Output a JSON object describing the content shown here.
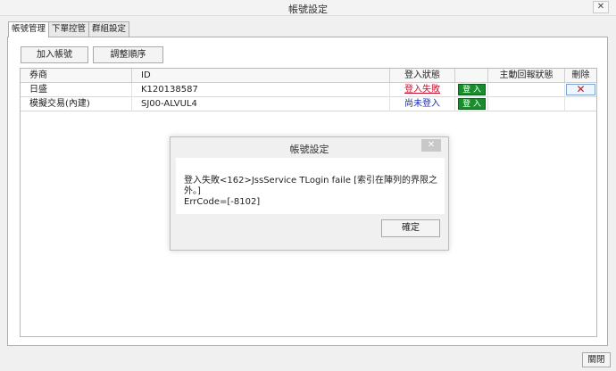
{
  "window": {
    "title": "帳號設定",
    "close_glyph": "✕"
  },
  "tabs": [
    {
      "label": "帳號管理",
      "active": true
    },
    {
      "label": "下單控管",
      "active": false
    },
    {
      "label": "群組設定",
      "active": false
    }
  ],
  "toolbar": {
    "add_account_label": "加入帳號",
    "reorder_label": "調整順序"
  },
  "grid": {
    "columns": [
      "券商",
      "ID",
      "登入狀態",
      "",
      "主動回報狀態",
      "刪除"
    ],
    "rows": [
      {
        "broker": "日盛",
        "id": "K120138587",
        "login_status": "登入失敗",
        "login_button": "登 入",
        "report_status": "",
        "delete_glyph": "✕"
      },
      {
        "broker": "模擬交易(內建)",
        "id": "SJ00-ALVUL4",
        "login_status": "尚未登入",
        "login_button": "登 入",
        "report_status": ""
      }
    ]
  },
  "dialog": {
    "title": "帳號設定",
    "close_glyph": "✕",
    "message_line1": "登入失敗<162>JssService TLogin faile [索引在陣列的界限之外。]",
    "message_line2": "ErrCode=[-8102]",
    "ok_label": "確定"
  },
  "footer": {
    "close_label": "關閉"
  },
  "colors": {
    "login_failed": "#c8102e",
    "not_logged_in": "#1a2fb5",
    "login_button": "#178d2b",
    "delete_icon": "#d01515"
  },
  "icons": {
    "close": "close-icon",
    "delete": "delete-x-icon"
  }
}
